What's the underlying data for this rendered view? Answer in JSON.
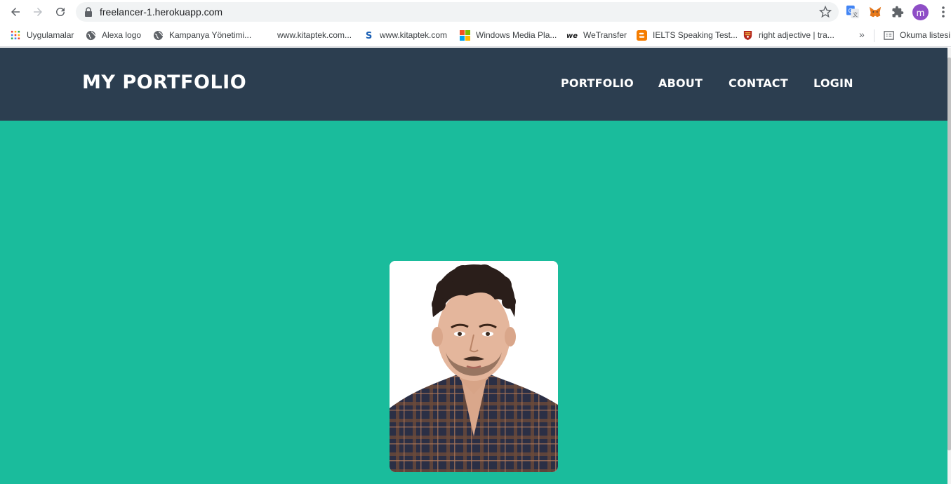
{
  "browser": {
    "url": "freelancer-1.herokuapp.com",
    "profile_initial": "m",
    "icons": {
      "back": "back-arrow-icon",
      "forward": "forward-arrow-icon",
      "reload": "reload-icon",
      "lock": "lock-icon",
      "bookmark_star": "star-icon",
      "translate": "google-translate-icon",
      "metamask": "metamask-fox-icon",
      "extensions": "puzzle-icon",
      "menu": "kebab-menu-icon"
    }
  },
  "bookmarks": {
    "items": [
      {
        "label": "Uygulamalar",
        "icon": "apps-grid-icon"
      },
      {
        "label": "Alexa logo",
        "icon": "globe-icon"
      },
      {
        "label": "Kampanya Yönetimi...",
        "icon": "globe-icon"
      },
      {
        "label": "www.kitaptek.com...",
        "icon": ""
      },
      {
        "label": "www.kitaptek.com",
        "icon": "s-logo-icon"
      },
      {
        "label": "Windows Media Pla...",
        "icon": "windows-logo-icon"
      },
      {
        "label": "WeTransfer",
        "icon": "wetransfer-logo-icon"
      },
      {
        "label": "IELTS Speaking Test...",
        "icon": "blogger-icon"
      },
      {
        "label": "right adjective | tra...",
        "icon": "cambridge-shield-icon"
      }
    ],
    "more": "»",
    "reading_list": "Okuma listesi"
  },
  "site": {
    "brand": "MY PORTFOLIO",
    "nav": [
      "PORTFOLIO",
      "ABOUT",
      "CONTACT",
      "LOGIN"
    ],
    "colors": {
      "navbar": "#2c3e50",
      "hero": "#1abc9c"
    },
    "profile_image": "portrait-photo"
  }
}
